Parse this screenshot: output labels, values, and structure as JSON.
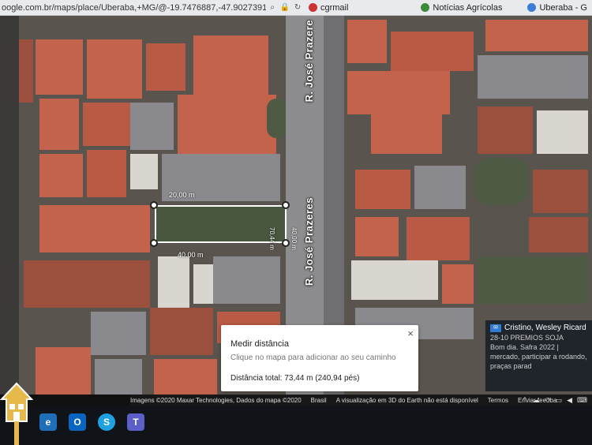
{
  "browser": {
    "url": "oogle.com.br/maps/place/Uberaba,+MG/@-19.7476887,-47.9027391,76m/d...",
    "tabs": [
      {
        "label": "cgrmail"
      },
      {
        "label": "Notícias Agrícolas"
      },
      {
        "label": "Uberaba - G"
      }
    ]
  },
  "map": {
    "street_top": "R. José Prazere",
    "street_bottom": "R. José Prazeres",
    "measure_labels": {
      "top": "20,00 m",
      "bottom": "40,00 m",
      "right_a": "70,44 m",
      "right_b": "40,00 m"
    }
  },
  "measure_panel": {
    "title": "Medir distância",
    "hint": "Clique no mapa para adicionar ao seu caminho",
    "total": "Distância total: 73,44 m (240,94 pés)",
    "close": "×"
  },
  "attribution": {
    "imagery": "Imagens ©2020 Maxar Technologies, Dados do mapa ©2020",
    "country": "Brasil",
    "notice": "A visualização em 3D do Earth não está disponível",
    "terms": "Termos",
    "feedback": "Enviar feedba"
  },
  "notification": {
    "sender": "Cristino, Wesley Ricard",
    "subject": "28-10 PREMIOS SOJA",
    "body": "Bom dia. Safra 2022 | mercado, participar a rodando, praças parad"
  },
  "colors": {
    "taskbar": "#101418",
    "popup_bg": "#ffffff",
    "notify_bg": "#20252c",
    "accent": "#2f7bd6"
  }
}
